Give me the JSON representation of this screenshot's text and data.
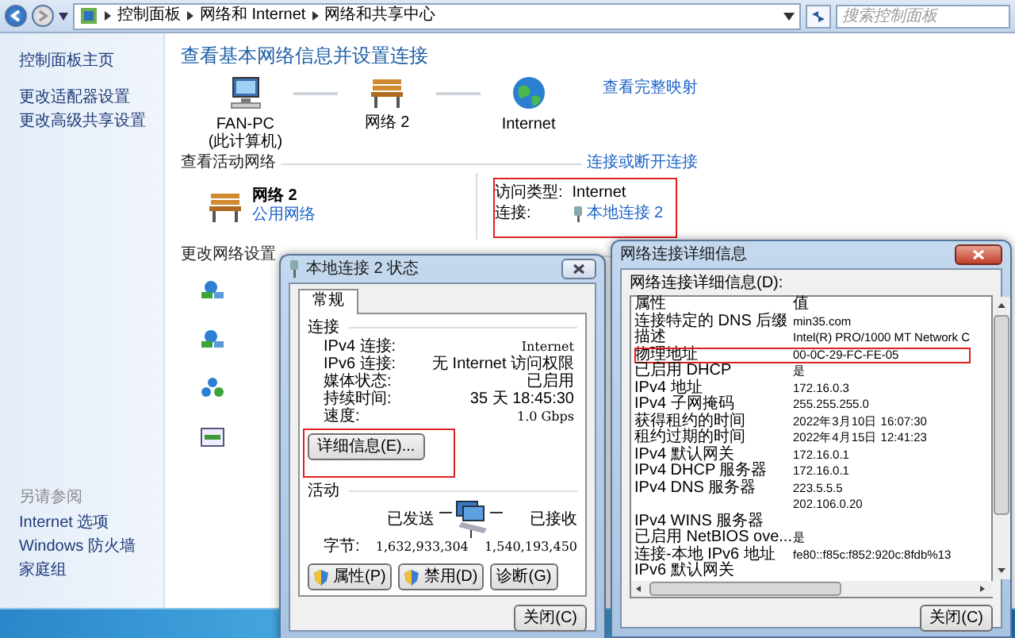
{
  "address_bar": {
    "breadcrumbs": [
      "控制面板",
      "网络和 Internet",
      "网络和共享中心"
    ],
    "search": {
      "placeholder": "搜索控制面板"
    }
  },
  "sidebar": {
    "items": [
      "控制面板主页",
      "更改适配器设置",
      "更改高级共享设置"
    ],
    "see_also": {
      "heading": "另请参阅",
      "items": [
        "Internet 选项",
        "Windows 防火墙",
        "家庭组"
      ]
    }
  },
  "main": {
    "title": "查看基本网络信息并设置连接",
    "map": {
      "nodes": [
        {
          "kind": "computer",
          "label": "FAN-PC",
          "sublabel": "(此计算机)"
        },
        {
          "kind": "network",
          "label": "网络  2"
        },
        {
          "kind": "internet",
          "label": "Internet"
        }
      ],
      "link": "查看完整映射"
    },
    "active_networks": {
      "heading": "查看活动网络",
      "link": "连接或断开连接",
      "network": {
        "name": "网络  2",
        "type": "公用网络"
      },
      "details": {
        "highlighted": true,
        "access_type_label": "访问类型:",
        "access_type": "Internet",
        "connection_label": "连接:",
        "connection": "本地连接 2"
      }
    },
    "change_settings": {
      "heading": "更改网络设置"
    }
  },
  "status_dialog": {
    "title": "本地连接 2 状态",
    "tabs": [
      {
        "label": "常规",
        "selected": true
      }
    ],
    "connection": {
      "heading": "连接",
      "rows": [
        {
          "label": "IPv4 连接:",
          "value": "Internet"
        },
        {
          "label": "IPv6 连接:",
          "value": "无 Internet 访问权限"
        },
        {
          "label": "媒体状态:",
          "value": "已启用"
        },
        {
          "label": "持续时间:",
          "value": "35 天 18:45:30"
        },
        {
          "label": "速度:",
          "value": "1.0 Gbps"
        }
      ]
    },
    "details_button": {
      "label": "详细信息(E)...",
      "highlighted": true
    },
    "activity": {
      "heading": "活动",
      "sent_label": "已发送",
      "received_label": "已接收",
      "bytes_label": "字节:",
      "sent": "1,632,933,304",
      "received": "1,540,193,450"
    },
    "buttons": [
      {
        "label": "属性(P)",
        "shield": true
      },
      {
        "label": "禁用(D)",
        "shield": true
      },
      {
        "label": "诊断(G)",
        "shield": false
      }
    ],
    "close": "关闭(C)"
  },
  "details_dialog": {
    "title": "网络连接详细信息",
    "list_label": "网络连接详细信息(D):",
    "columns": [
      "属性",
      "值"
    ],
    "rows": [
      {
        "property": "连接特定的 DNS 后缀",
        "value": "min35.com",
        "highlighted": false
      },
      {
        "property": "描述",
        "value": "Intel(R) PRO/1000 MT Network C",
        "highlighted": false
      },
      {
        "property": "物理地址",
        "value": "00-0C-29-FC-FE-05",
        "highlighted": true
      },
      {
        "property": "已启用 DHCP",
        "value": "是",
        "highlighted": false
      },
      {
        "property": "IPv4 地址",
        "value": "172.16.0.3",
        "highlighted": false
      },
      {
        "property": "IPv4 子网掩码",
        "value": "255.255.255.0",
        "highlighted": false
      },
      {
        "property": "获得租约的时间",
        "value": "2022年3月10日 16:07:30",
        "highlighted": false
      },
      {
        "property": "租约过期的时间",
        "value": "2022年4月15日 12:41:23",
        "highlighted": false
      },
      {
        "property": "IPv4 默认网关",
        "value": "172.16.0.1",
        "highlighted": false
      },
      {
        "property": "IPv4 DHCP 服务器",
        "value": "172.16.0.1",
        "highlighted": false
      },
      {
        "property": "IPv4 DNS 服务器",
        "value": "223.5.5.5",
        "highlighted": false
      },
      {
        "value": "202.106.0.20",
        "highlighted": false
      },
      {
        "property": "IPv4 WINS 服务器",
        "highlighted": false
      },
      {
        "property": "已启用 NetBIOS ove...",
        "value": "是",
        "highlighted": false
      },
      {
        "property": "连接-本地 IPv6 地址",
        "value": "fe80::f85c:f852:920c:8fdb%13",
        "highlighted": false
      },
      {
        "property": "IPv6 默认网关",
        "highlighted": false
      }
    ],
    "close": "关闭(C)"
  }
}
